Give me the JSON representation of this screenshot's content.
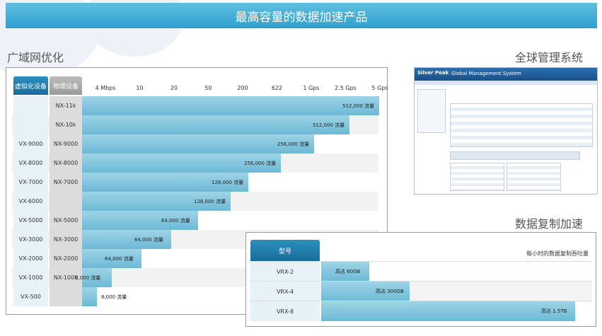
{
  "banner_title": "最高容量的数据加速产品",
  "wan": {
    "title": "广域网优化",
    "col_virtual": "虚拟化设备",
    "col_physical": "物理设备",
    "ticks": [
      "4 Mbps",
      "10",
      "20",
      "50",
      "200",
      "622",
      "1 Gps",
      "2.5 Gps",
      "5 Gps"
    ],
    "rows": [
      {
        "virtual": "",
        "physical": "NX-11k",
        "value": 1.0,
        "label": "512,000 流量"
      },
      {
        "virtual": "",
        "physical": "NX-10k",
        "value": 0.9,
        "label": "512,000 流量"
      },
      {
        "virtual": "VX-9000",
        "physical": "NX-9000",
        "value": 0.78,
        "label": "256,000 流量"
      },
      {
        "virtual": "VX-8000",
        "physical": "NX-8000",
        "value": 0.67,
        "label": "256,000 流量"
      },
      {
        "virtual": "VX-7000",
        "physical": "NX-7000",
        "value": 0.56,
        "label": "128,000 流量"
      },
      {
        "virtual": "VX-6000",
        "physical": "",
        "value": 0.5,
        "label": "128,000 流量"
      },
      {
        "virtual": "VX-5000",
        "physical": "NX-5000",
        "value": 0.39,
        "label": "64,000 流量"
      },
      {
        "virtual": "VX-3000",
        "physical": "NX-3000",
        "value": 0.3,
        "label": "64,000 流量"
      },
      {
        "virtual": "VX-2000",
        "physical": "NX-2000",
        "value": 0.2,
        "label": "64,000 流量"
      },
      {
        "virtual": "VX-1000",
        "physical": "NX-1000",
        "value": 0.1,
        "label": "8,000 流量"
      },
      {
        "virtual": "VX-500",
        "physical": "",
        "value": 0.05,
        "label": "8,000 流量"
      }
    ]
  },
  "gms": {
    "title": "全球管理系统",
    "logo": "Silver Peak",
    "app_title": "Global Management System"
  },
  "replication": {
    "title": "数据复制加速",
    "col_model": "型号",
    "caption": "每小时的数据复制吞吐量",
    "rows": [
      {
        "model": "VRX-2",
        "value": 0.18,
        "label": "高达 60GB"
      },
      {
        "model": "VRX-4",
        "value": 0.33,
        "label": "高达 300GB"
      },
      {
        "model": "VRX-8",
        "value": 0.95,
        "label": "高达 1.5TB"
      }
    ]
  },
  "colors": {
    "banner": "#3aa7d4",
    "bar": "#7cc2dc",
    "header_blue": "#1e7fb0",
    "header_gray": "#a9a9a9"
  }
}
